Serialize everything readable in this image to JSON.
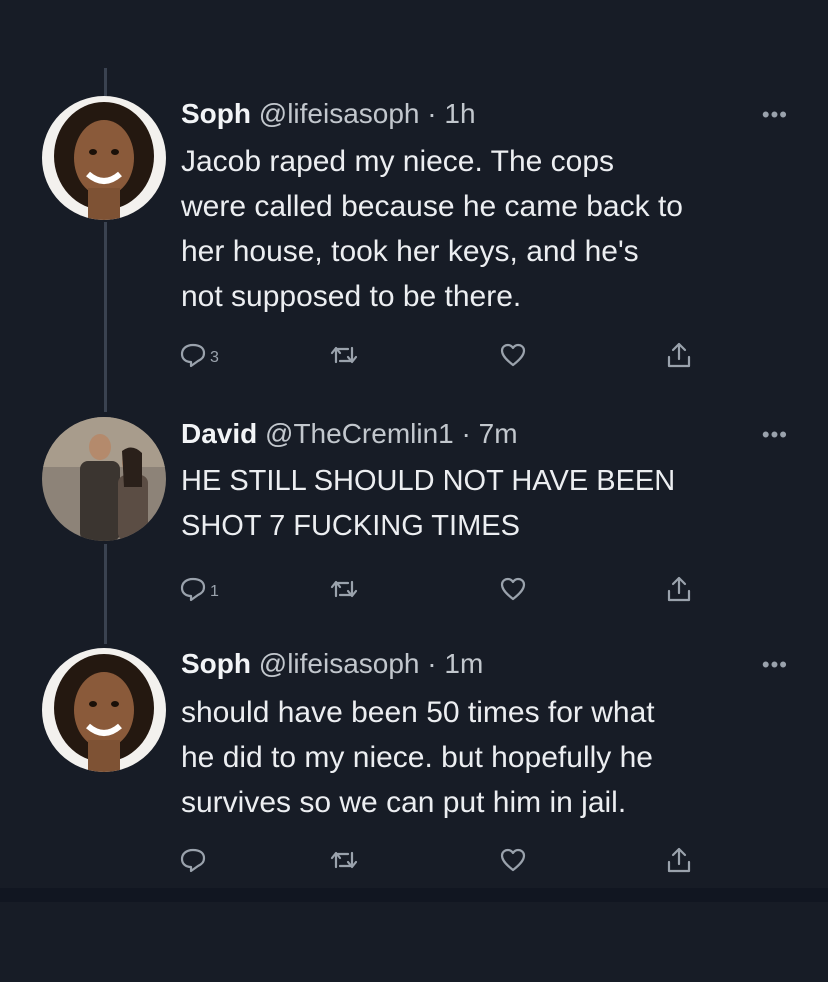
{
  "tweets": [
    {
      "name": "Soph",
      "handle": "@lifeisasoph",
      "time": "· 1h",
      "text_lines": [
        "Jacob raped my niece. The cops",
        "were called because he came back to",
        "her house, took her keys, and he's",
        "not supposed to be there."
      ],
      "replies": "3"
    },
    {
      "name": "David",
      "handle": "@TheCremlin1",
      "time": "· 7m",
      "text_lines": [
        "HE STILL SHOULD NOT HAVE BEEN",
        "SHOT 7 FUCKING TIMES"
      ],
      "replies": "1"
    },
    {
      "name": "Soph",
      "handle": "@lifeisasoph",
      "time": "· 1m",
      "text_lines": [
        "should have been 50 times for what",
        "he did to my niece. but hopefully he",
        "survives so we can put him in jail."
      ],
      "replies": ""
    }
  ],
  "more_glyph": "•••",
  "colors": {
    "background": "#171c26",
    "thread_line": "#3a4250",
    "text": "#eceef1",
    "secondary": "#9aa2ac"
  },
  "icons": [
    "reply-icon",
    "retweet-icon",
    "like-icon",
    "share-icon",
    "more-icon"
  ]
}
